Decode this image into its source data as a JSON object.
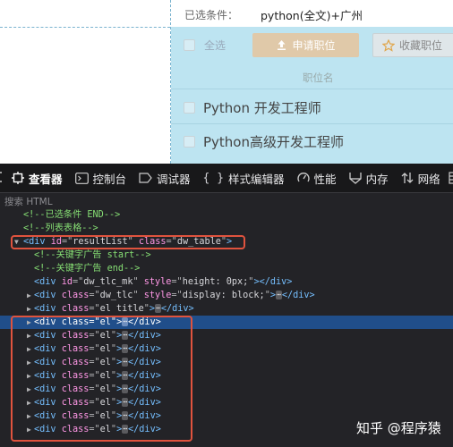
{
  "page": {
    "filter_label": "已选条件：",
    "filter_value": "python(全文)+广州",
    "select_all": "全选",
    "apply_button": "申请职位",
    "favorite_button": "收藏职位",
    "column_header": "职位名",
    "jobs": [
      "Python 开发工程师",
      "Python高级开发工程师"
    ]
  },
  "toolbar": {
    "tabs": [
      "查看器",
      "控制台",
      "调试器",
      "样式编辑器",
      "性能",
      "内存",
      "网络"
    ],
    "active_tab": "查看器"
  },
  "search": {
    "placeholder": "搜索 HTML"
  },
  "tree": {
    "comment_filter_end": "<!--已选条件 END-->",
    "comment_list": "<!--列表表格-->",
    "resultlist_tag": "div",
    "resultlist_id": "resultList",
    "resultlist_class": "dw_table",
    "comment_ad_start": "<!--关键字广告 start-->",
    "comment_ad_end": "<!--关键字广告 end-->",
    "div_mk_id": "dw_tlc_mk",
    "div_mk_style": "height: 0px;",
    "div_tlc_class": "dw_tlc",
    "div_tlc_style": "display: block;",
    "div_title_class": "el title",
    "el_class": "el",
    "el_count": 9,
    "ellipsis": "⋯"
  },
  "watermark": "知乎 @程序猿"
}
